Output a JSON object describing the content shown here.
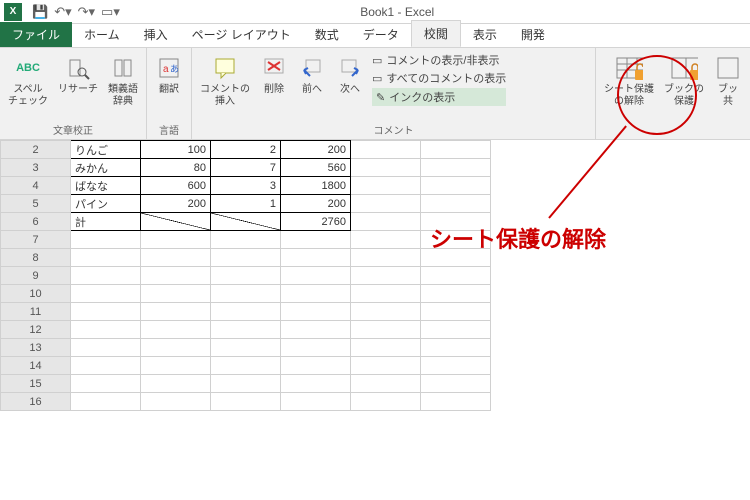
{
  "titlebar": {
    "appicon": "X",
    "title": "Book1 - Excel"
  },
  "tabs": {
    "file": "ファイル",
    "home": "ホーム",
    "insert": "挿入",
    "pagelayout": "ページ レイアウト",
    "formulas": "数式",
    "data": "データ",
    "review": "校閲",
    "view": "表示",
    "developer": "開発"
  },
  "ribbon": {
    "spelling_top": "ABC",
    "spelling": "スペル\nチェック",
    "research": "リサーチ",
    "thesaurus": "類義語\n辞典",
    "group_proofing": "文章校正",
    "translate": "翻訳",
    "group_language": "言語",
    "newcomment": "コメントの\n挿入",
    "delete": "削除",
    "prev": "前へ",
    "next": "次へ",
    "showhide": "コメントの表示/非表示",
    "showall": "すべてのコメントの表示",
    "showink": "インクの表示",
    "group_comments": "コメント",
    "unprotect": "シート保護\nの解除",
    "protectbook": "ブックの\n保護",
    "sharebook": "ブッ\n共"
  },
  "rows": [
    {
      "n": "2",
      "a": "りんご",
      "b": "100",
      "c": "2",
      "d": "200"
    },
    {
      "n": "3",
      "a": "みかん",
      "b": "80",
      "c": "7",
      "d": "560"
    },
    {
      "n": "4",
      "a": "ばなな",
      "b": "600",
      "c": "3",
      "d": "1800"
    },
    {
      "n": "5",
      "a": "パイン",
      "b": "200",
      "c": "1",
      "d": "200"
    },
    {
      "n": "6",
      "a": "計",
      "b": "",
      "c": "",
      "d": "2760"
    },
    {
      "n": "7"
    },
    {
      "n": "8"
    },
    {
      "n": "9"
    },
    {
      "n": "10"
    },
    {
      "n": "11"
    },
    {
      "n": "12"
    },
    {
      "n": "13"
    },
    {
      "n": "14"
    },
    {
      "n": "15"
    },
    {
      "n": "16"
    }
  ],
  "annotation": {
    "text": "シート保護の解除"
  }
}
